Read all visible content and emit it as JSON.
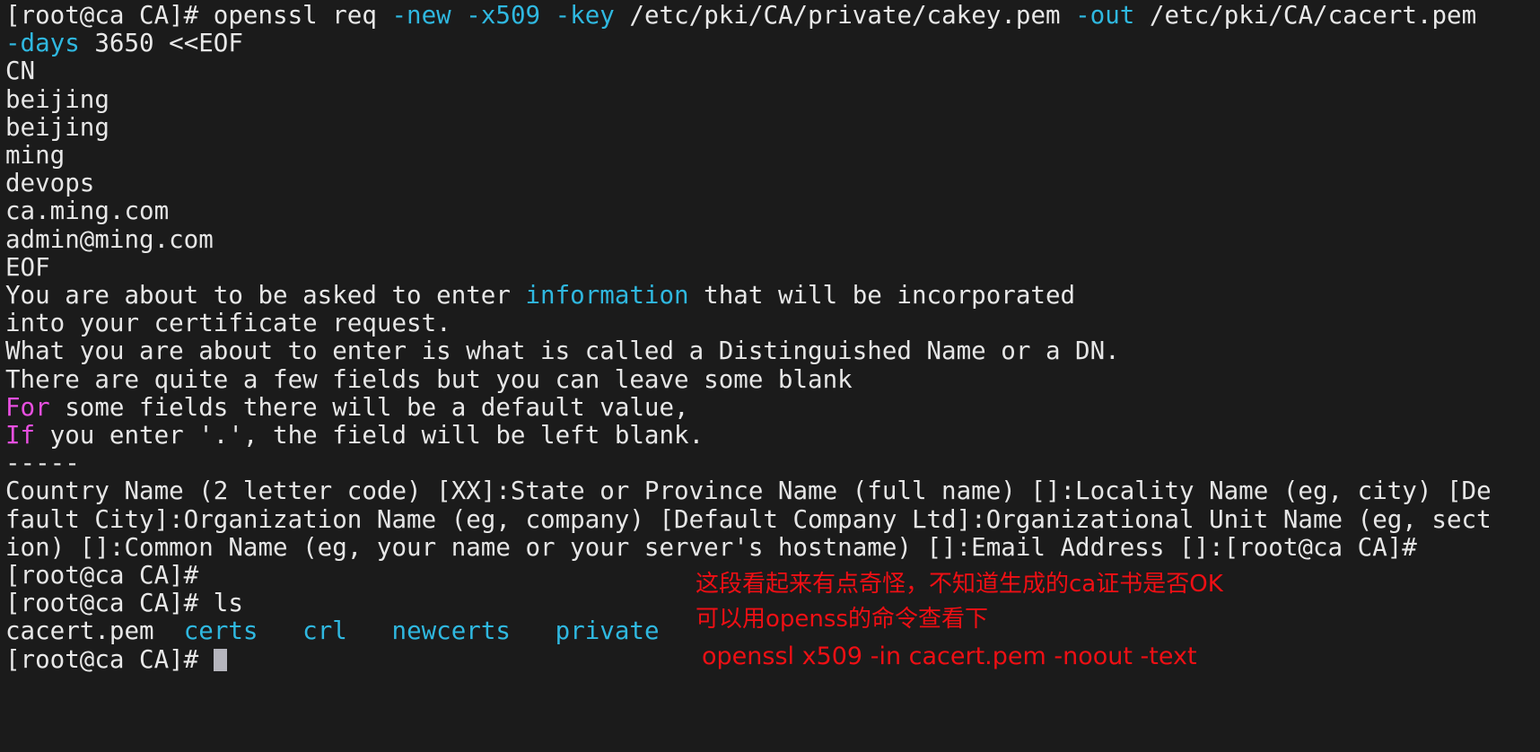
{
  "terminal": {
    "background_color": "#1b1b1b",
    "foreground_color": "#e6e6e6",
    "accent_cyan": "#2fb8e0",
    "accent_magenta": "#e84fe0",
    "annotation_color": "#ef0f14",
    "prompt": "[root@ca CA]#",
    "lines": {
      "l1_prompt": "[root@ca CA]# ",
      "l1_cmd": "openssl req ",
      "l1_flag_new": "-new",
      "l1_sp1": " ",
      "l1_flag_x509": "-x509",
      "l1_sp2": " ",
      "l1_flag_key": "-key",
      "l1_keypath": " /etc/pki/CA/private/cakey.pem ",
      "l1_flag_out": "-out",
      "l1_outpath": " /etc/pki/CA/cacert.pem",
      "l2_flag_days": "-days",
      "l2_rest": " 3650 <<EOF",
      "l3": "CN",
      "l4": "beijing",
      "l5": "beijing",
      "l6": "ming",
      "l7": "devops",
      "l8": "ca.ming.com",
      "l9": "admin@ming.com",
      "l10": "EOF",
      "l11_a": "You are about to be asked to enter ",
      "l11_kw": "information",
      "l11_b": " that will be incorporated",
      "l12": "into your certificate request.",
      "l13": "What you are about to enter is what is called a Distinguished Name or a DN.",
      "l14": "There are quite a few fields but you can leave some blank",
      "l15_kw": "For",
      "l15_rest": " some fields there will be a default value,",
      "l16_kw": "If",
      "l16_rest": " you enter '.', the field will be left blank.",
      "l17": "-----",
      "l18": "Country Name (2 letter code) [XX]:State or Province Name (full name) []:Locality Name (eg, city) [De",
      "l19": "fault City]:Organization Name (eg, company) [Default Company Ltd]:Organizational Unit Name (eg, sect",
      "l20": "ion) []:Common Name (eg, your name or your server's hostname) []:Email Address []:[root@ca CA]#",
      "l21": "[root@ca CA]#",
      "l22_prompt": "[root@ca CA]# ",
      "l22_cmd": "ls",
      "l23_file": "cacert.pem",
      "l23_gap1": "  ",
      "l23_dir1": "certs",
      "l23_gap2": "   ",
      "l23_dir2": "crl",
      "l23_gap3": "   ",
      "l23_dir3": "newcerts",
      "l23_gap4": "   ",
      "l23_dir4": "private",
      "l24_prompt": "[root@ca CA]# "
    }
  },
  "annotations": {
    "line_1": "这段看起来有点奇怪，不知道生成的ca证书是否OK",
    "line_2": "可以用openss的命令查看下",
    "command": "openssl x509 -in cacert.pem -noout -text"
  }
}
